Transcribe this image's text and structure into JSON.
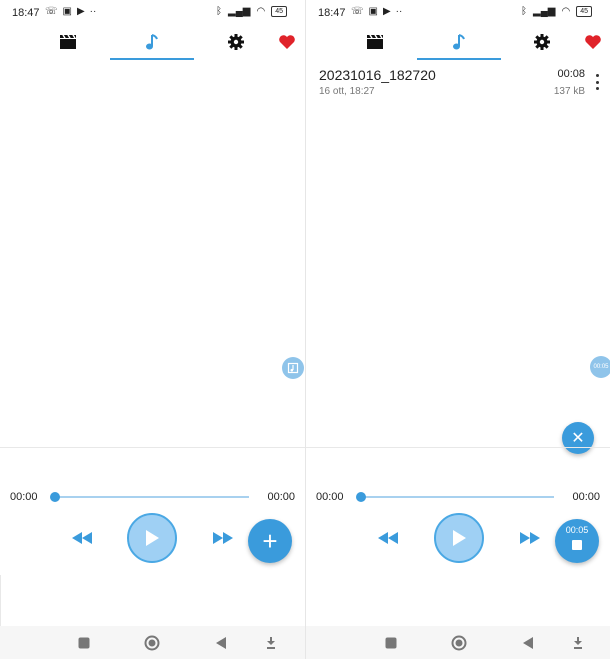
{
  "status_bar": {
    "time": "18:47",
    "battery": "45"
  },
  "tabs": [
    {
      "icon": "video-clapper-icon",
      "selected": false
    },
    {
      "icon": "music-note-icon",
      "selected": true
    },
    {
      "icon": "gear-icon",
      "selected": false
    },
    {
      "icon": "heart-icon",
      "selected": false
    }
  ],
  "left_screen": {
    "player": {
      "current_time": "00:00",
      "total_time": "00:00"
    },
    "fab_label": "+"
  },
  "right_screen": {
    "recordings": [
      {
        "title": "20231016_182720",
        "date": "16 ott, 18:27",
        "duration": "00:08",
        "size": "137 kB"
      }
    ],
    "side_bubble_text": "00:05",
    "player": {
      "current_time": "00:00",
      "total_time": "00:00"
    },
    "recording_elapsed": "00:05",
    "cancel_label": "✕"
  },
  "colors": {
    "accent": "#3a9bdc",
    "accent_light": "#9fd0f4",
    "heart": "#e0232a"
  }
}
